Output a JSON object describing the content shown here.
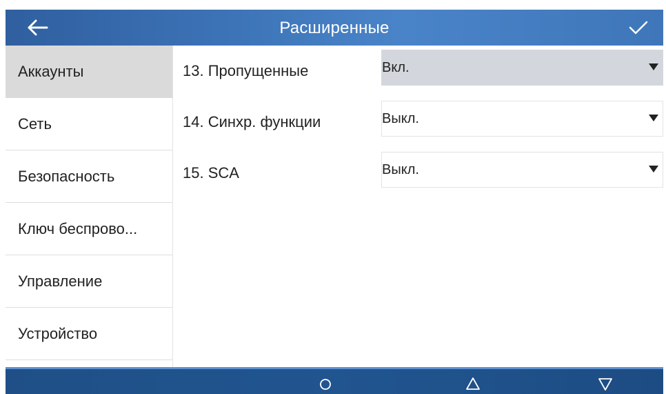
{
  "header": {
    "title": "Расширенные",
    "back_icon": "arrow-left-icon",
    "save_icon": "check-icon"
  },
  "sidebar": {
    "items": [
      {
        "label": "Аккаунты",
        "active": true
      },
      {
        "label": "Сеть",
        "active": false
      },
      {
        "label": "Безопасность",
        "active": false
      },
      {
        "label": "Ключ беспрово...",
        "active": false
      },
      {
        "label": "Управление",
        "active": false
      },
      {
        "label": "Устройство",
        "active": false
      }
    ]
  },
  "settings": {
    "rows": [
      {
        "label": "13. Пропущенные",
        "value": "Вкл."
      },
      {
        "label": "14. Синхр. функции",
        "value": "Выкл."
      },
      {
        "label": "15. SCA",
        "value": "Выкл."
      }
    ]
  },
  "navbar": {
    "home_icon": "circle-icon",
    "up_icon": "triangle-up-icon",
    "down_icon": "triangle-down-icon"
  },
  "colors": {
    "header": "#3d74b8",
    "navbar": "#215590",
    "active_sidebar": "#dadada",
    "focused_select": "#d3d7dd"
  }
}
